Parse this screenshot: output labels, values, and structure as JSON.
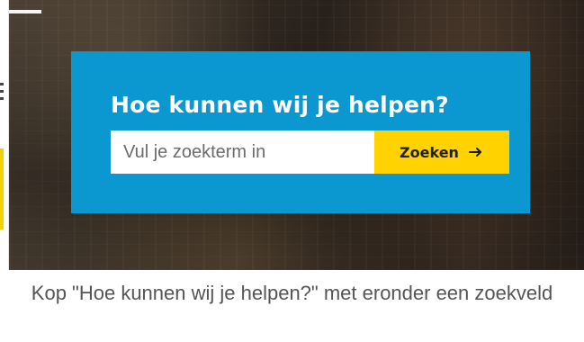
{
  "hero": {
    "title": "Hoe kunnen wij je helpen?",
    "search": {
      "placeholder": "Vul je zoekterm in",
      "button_label": "Zoeken",
      "button_icon": "arrow-right-icon"
    }
  },
  "caption": {
    "text": "Kop \"Hoe kunnen wij je helpen?\" met eronder een zoekveld"
  },
  "colors": {
    "card_blue": "#0b97cf",
    "button_yellow": "#ffd200",
    "title_white": "#ffffff",
    "caption_text": "#555555"
  }
}
